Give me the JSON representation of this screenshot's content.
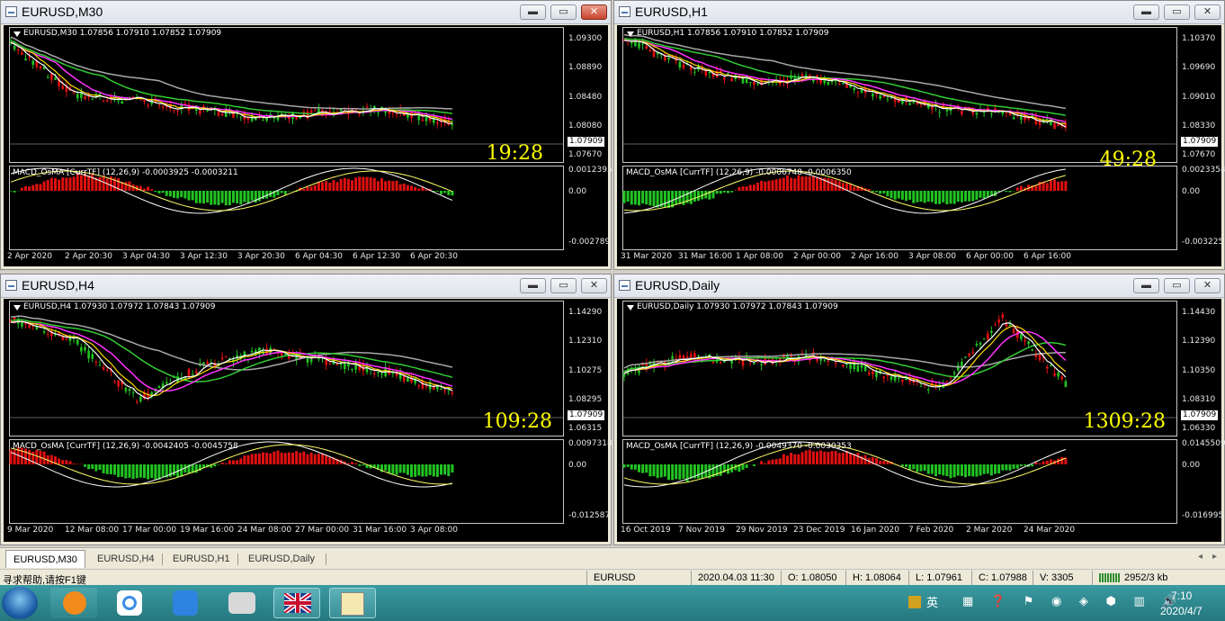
{
  "windows": [
    {
      "id": "m30",
      "title": "EURUSD,M30",
      "header": "EURUSD,M30  1.07856 1.07910 1.07852 1.07909",
      "y_labels": [
        "1.09300",
        "1.08890",
        "1.08480",
        "1.08080",
        "1.07670"
      ],
      "current_price": "1.07909",
      "timer": "19:28",
      "macd_header": "MACD_OsMA [CurrTF] (12,26,9) -0.0003925 -0.0003211",
      "macd_labels": [
        "0.0012395",
        "0.00",
        "-0.002789"
      ],
      "x_labels": [
        "2 Apr 2020",
        "2 Apr 20:30",
        "3 Apr 04:30",
        "3 Apr 12:30",
        "3 Apr 20:30",
        "6 Apr 04:30",
        "6 Apr 12:30",
        "6 Apr 20:30"
      ],
      "active": true
    },
    {
      "id": "h1",
      "title": "EURUSD,H1",
      "header": "EURUSD,H1  1.07856 1.07910 1.07852 1.07909",
      "y_labels": [
        "1.10370",
        "1.09690",
        "1.09010",
        "1.08330",
        "1.07670"
      ],
      "current_price": "1.07909",
      "timer": "49:28",
      "macd_header": "MACD_OsMA [CurrTF] (12,26,9) -0.0006748 -0.0006350",
      "macd_labels": [
        "0.0023354",
        "0.00",
        "-0.003225"
      ],
      "x_labels": [
        "31 Mar 2020",
        "31 Mar 16:00",
        "1 Apr 08:00",
        "2 Apr 00:00",
        "2 Apr 16:00",
        "3 Apr 08:00",
        "6 Apr 00:00",
        "6 Apr 16:00"
      ],
      "active": false
    },
    {
      "id": "h4",
      "title": "EURUSD,H4",
      "header": "EURUSD,H4  1.07930 1.07972 1.07843 1.07909",
      "y_labels": [
        "1.14290",
        "1.12310",
        "1.10275",
        "1.08295",
        "1.06315"
      ],
      "current_price": "1.07909",
      "timer": "109:28",
      "macd_header": "MACD_OsMA [CurrTF] (12,26,9) -0.0042405 -0.0045758",
      "macd_labels": [
        "0.0097318",
        "0.00",
        "-0.012587"
      ],
      "x_labels": [
        "9 Mar 2020",
        "12 Mar 08:00",
        "17 Mar 00:00",
        "19 Mar 16:00",
        "24 Mar 08:00",
        "27 Mar 00:00",
        "31 Mar 16:00",
        "3 Apr 08:00"
      ],
      "active": false
    },
    {
      "id": "d1",
      "title": "EURUSD,Daily",
      "header": "EURUSD,Daily  1.07930 1.07972 1.07843 1.07909",
      "y_labels": [
        "1.14430",
        "1.12390",
        "1.10350",
        "1.08310",
        "1.06330"
      ],
      "current_price": "1.07909",
      "timer": "1309:28",
      "macd_header": "MACD_OsMA [CurrTF] (12,26,9) -0.0049370 -0.0030353",
      "macd_labels": [
        "0.0145509",
        "0.00",
        "-0.016995"
      ],
      "x_labels": [
        "16 Oct 2019",
        "7 Nov 2019",
        "29 Nov 2019",
        "23 Dec 2019",
        "16 Jan 2020",
        "7 Feb 2020",
        "2 Mar 2020",
        "24 Mar 2020"
      ],
      "active": false
    }
  ],
  "tabs": [
    "EURUSD,M30",
    "EURUSD,H4",
    "EURUSD,H1",
    "EURUSD,Daily"
  ],
  "status": {
    "help": "寻求帮助,请按F1键",
    "symbol": "EURUSD",
    "datetime": "2020.04.03 11:30",
    "open": "O: 1.08050",
    "high": "H: 1.08064",
    "low": "L: 1.07961",
    "close": "C: 1.07988",
    "volume": "V: 3305",
    "traffic": "2952/3 kb"
  },
  "taskbar": {
    "lang": "英",
    "clock_time": "7:10",
    "clock_date": "2020/4/7"
  },
  "colors": {
    "bull": "#22c322",
    "bear": "#e01010",
    "ma_fast": "#ffffff",
    "ma_mid": "#ffd700",
    "ma_slow": "#ff33ff",
    "ma_long": "#33cc33",
    "ma_trend": "#a8a8a8"
  }
}
